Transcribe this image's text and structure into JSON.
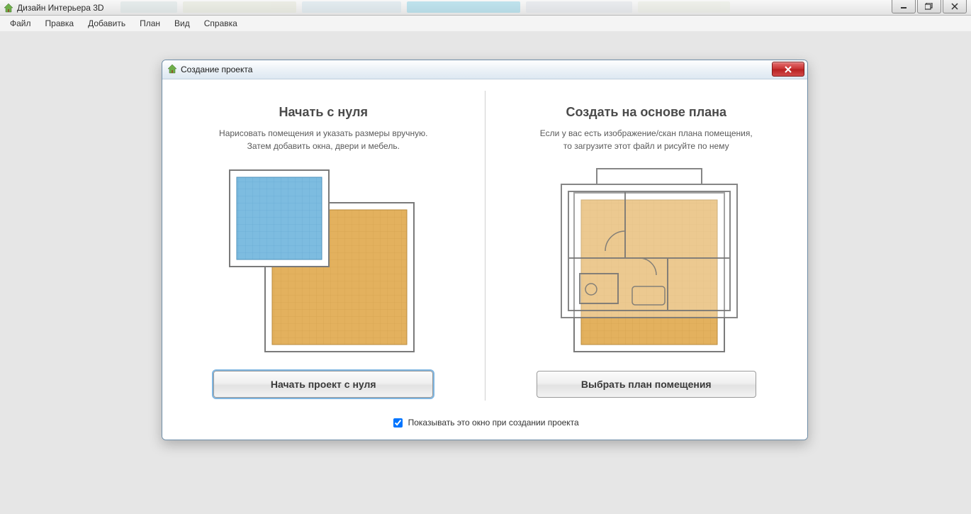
{
  "app": {
    "title": "Дизайн Интерьера 3D",
    "menu": [
      "Файл",
      "Правка",
      "Добавить",
      "План",
      "Вид",
      "Справка"
    ]
  },
  "dialog": {
    "title": "Создание проекта",
    "left": {
      "heading": "Начать с нуля",
      "desc_line1": "Нарисовать помещения и указать размеры вручную.",
      "desc_line2": "Затем добавить окна, двери и мебель.",
      "button": "Начать проект с нуля"
    },
    "right": {
      "heading": "Создать на основе плана",
      "desc_line1": "Если у вас есть изображение/скан плана помещения,",
      "desc_line2": "то загрузите этот файл и рисуйте по нему",
      "button": "Выбрать план помещения"
    },
    "footer_checkbox_label": "Показывать это окно при создании проекта",
    "footer_checked": true
  },
  "icons": {
    "app": "house-icon",
    "dialog": "house-icon",
    "min": "minimize-icon",
    "max": "maximize-icon",
    "close": "close-icon"
  }
}
